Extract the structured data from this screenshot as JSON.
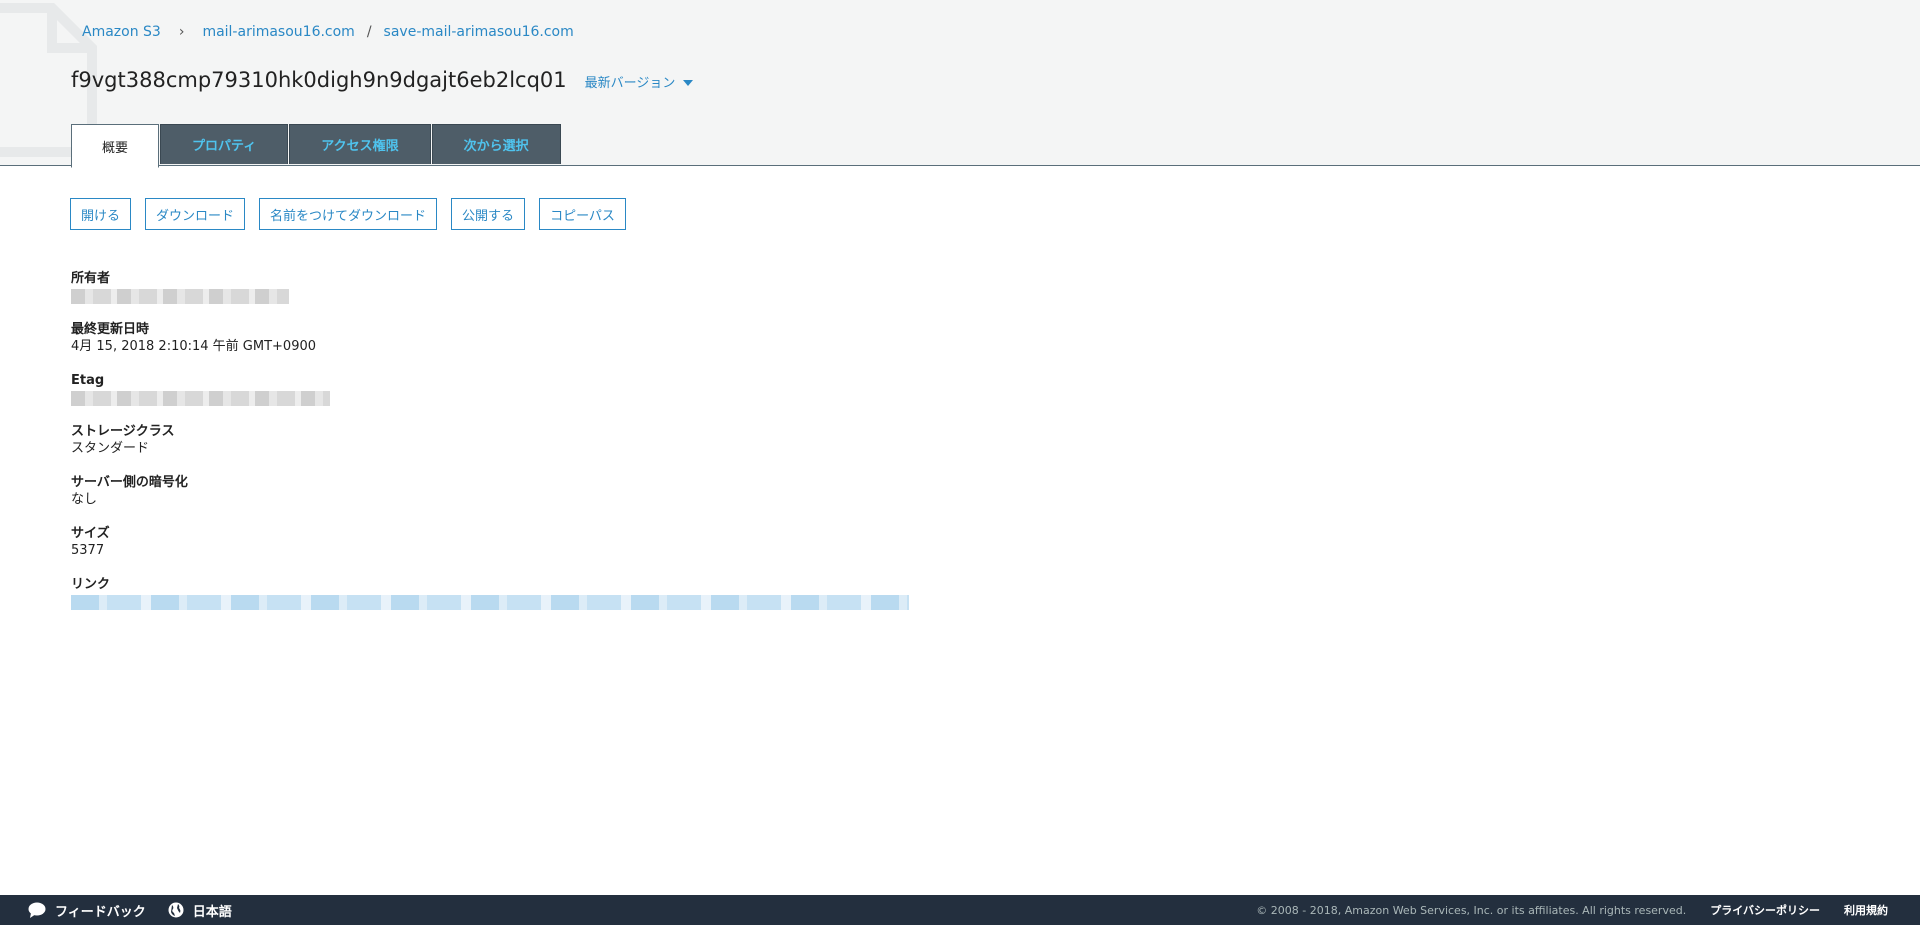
{
  "breadcrumb": {
    "root": "Amazon S3",
    "bucket": "mail-arimasou16.com",
    "folder": "save-mail-arimasou16.com"
  },
  "object": {
    "title": "f9vgt388cmp79310hk0digh9n9dgajt6eb2lcq01",
    "version_label": "最新バージョン"
  },
  "tabs": [
    {
      "label": "概要",
      "active": true
    },
    {
      "label": "プロパティ",
      "active": false
    },
    {
      "label": "アクセス権限",
      "active": false
    },
    {
      "label": "次から選択",
      "active": false
    }
  ],
  "actions": {
    "open": "開ける",
    "download": "ダウンロード",
    "download_as": "名前をつけてダウンロード",
    "make_public": "公開する",
    "copy_path": "コピーパス"
  },
  "details": {
    "owner_label": "所有者",
    "modified_label": "最終更新日時",
    "modified_value": "4月 15, 2018 2:10:14 午前 GMT+0900",
    "etag_label": "Etag",
    "storage_label": "ストレージクラス",
    "storage_value": "スタンダード",
    "encryption_label": "サーバー側の暗号化",
    "encryption_value": "なし",
    "size_label": "サイズ",
    "size_value": "5377",
    "link_label": "リンク"
  },
  "footer": {
    "feedback": "フィードバック",
    "language": "日本語",
    "copyright": "© 2008 - 2018, Amazon Web Services, Inc. or its affiliates. All rights reserved.",
    "privacy": "プライバシーポリシー",
    "terms": "利用規約"
  },
  "icons": {
    "feedback": "speech-bubble-icon",
    "language": "globe-icon"
  },
  "colors": {
    "link": "#2a88c5",
    "tab_bg": "#4e5d68",
    "tab_text": "#4fc3ee",
    "footer_bg": "#232f3e"
  }
}
